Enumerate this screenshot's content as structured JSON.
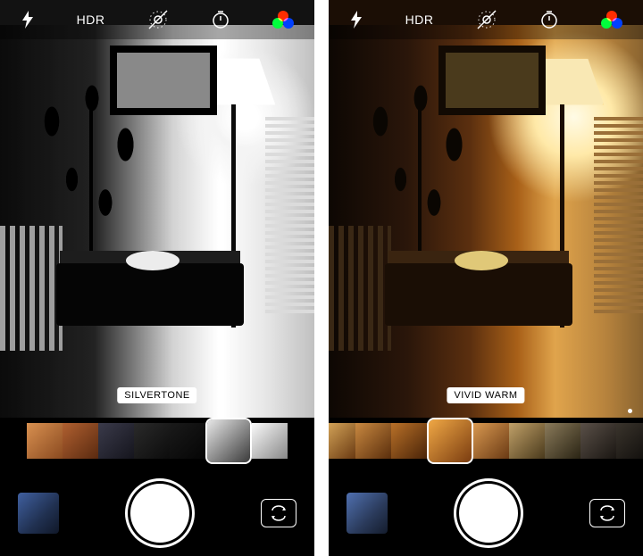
{
  "left": {
    "hdr_label": "HDR",
    "filter_name": "SILVERTONE",
    "icons": {
      "flash": "flash-auto",
      "live": "live-photo-off",
      "timer": "timer",
      "filters": "filters"
    },
    "filter_thumbs_count": 7,
    "selected_thumb_index": 5
  },
  "right": {
    "hdr_label": "HDR",
    "filter_name": "VIVID WARM",
    "icons": {
      "flash": "flash-auto",
      "live": "live-photo-off",
      "timer": "timer",
      "filters": "filters"
    },
    "filter_thumbs_count": 9,
    "selected_thumb_index": 3
  }
}
